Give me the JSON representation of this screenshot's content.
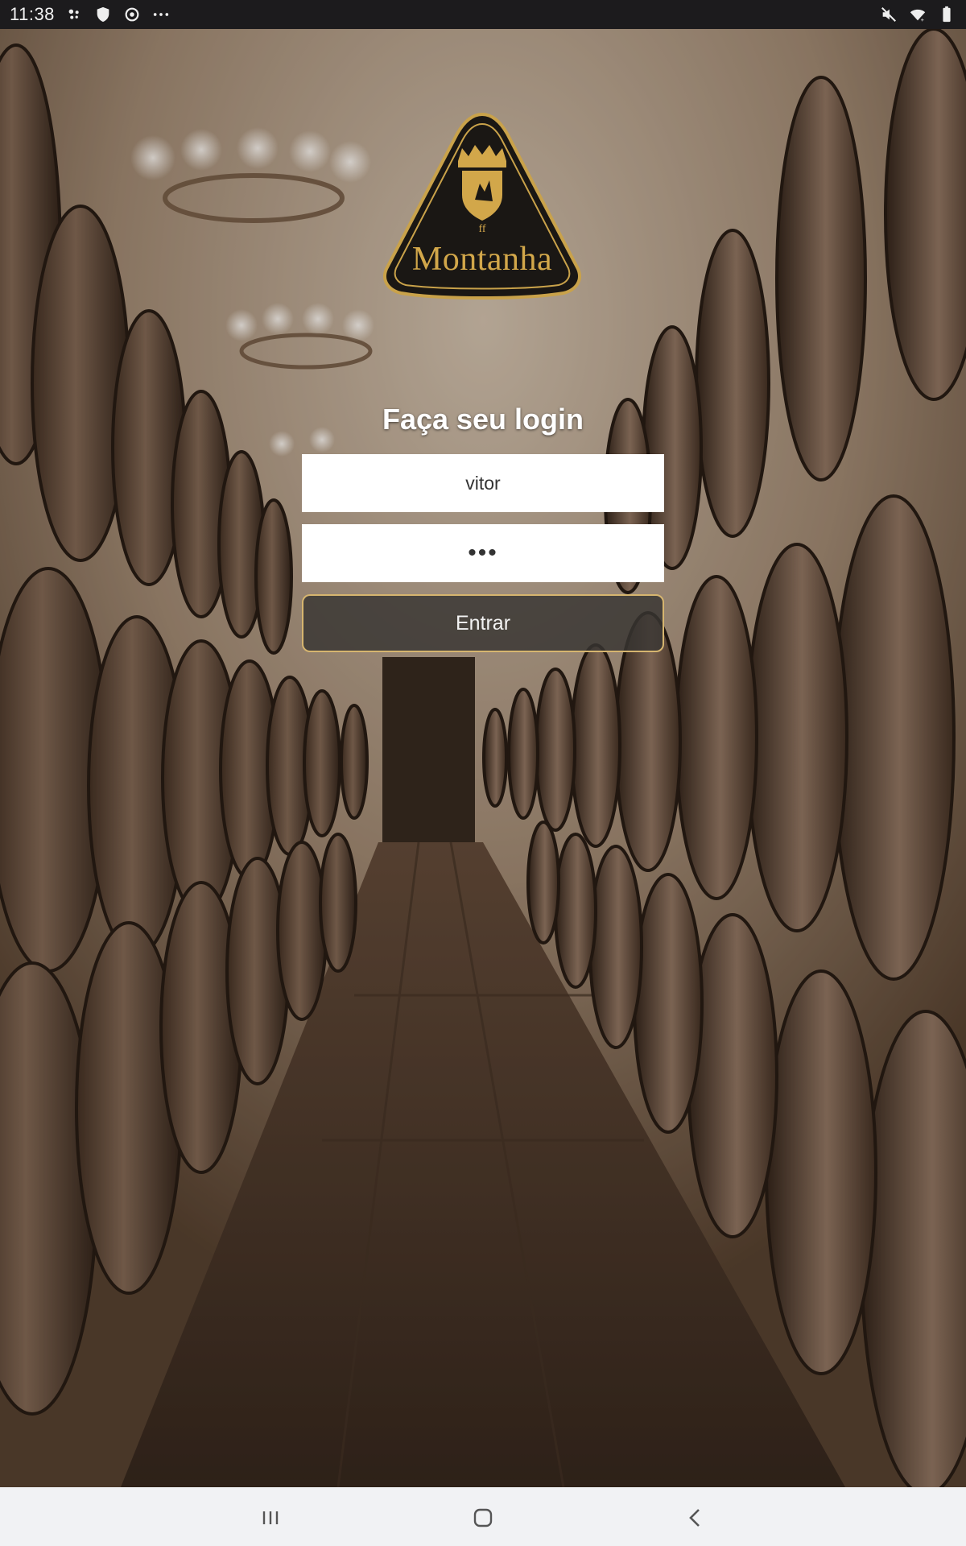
{
  "status_bar": {
    "time": "11:38",
    "left_icons": [
      "slack-icon",
      "shield-icon",
      "sync-icon",
      "more-dots-icon"
    ],
    "right_icons": [
      "mute-icon",
      "wifi-icon",
      "battery-icon"
    ]
  },
  "brand": {
    "name": "Montanha",
    "accent": "#d2a74a"
  },
  "login": {
    "title": "Faça seu login",
    "username_value": "vitor",
    "password_display": "•••",
    "submit_label": "Entrar"
  },
  "nav_bar": {
    "buttons": [
      "recent-apps-icon",
      "home-icon",
      "back-icon"
    ]
  }
}
